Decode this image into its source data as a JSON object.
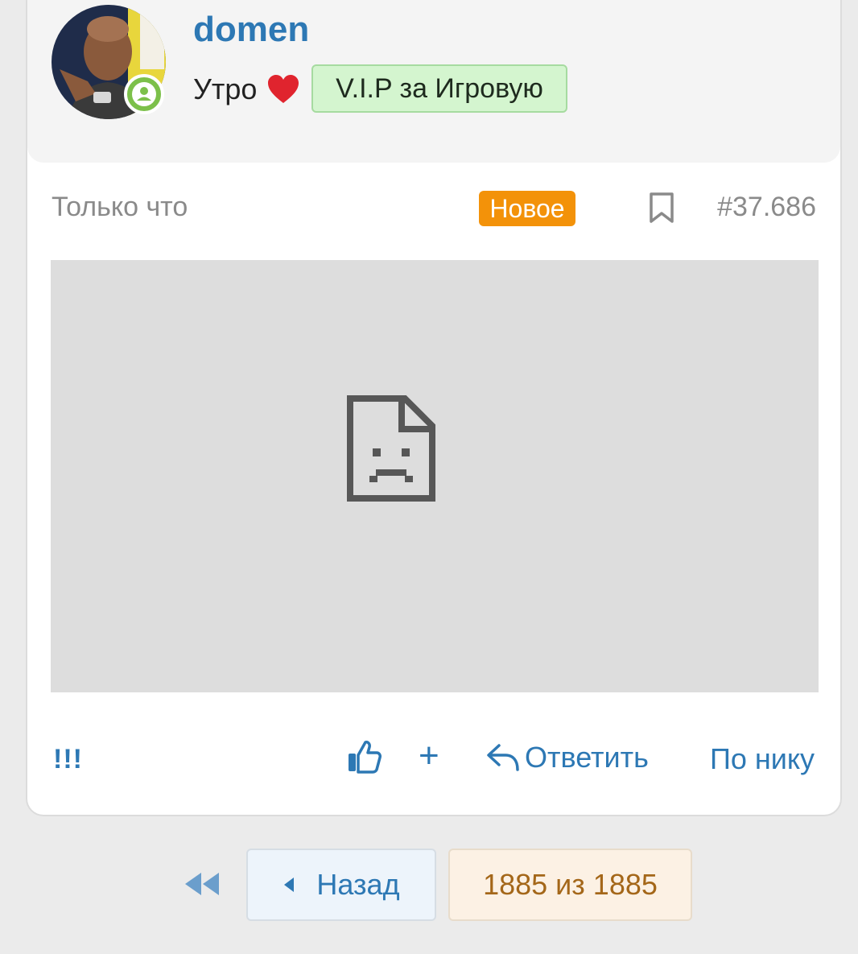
{
  "post": {
    "author": {
      "username": "domen",
      "title": "Утро",
      "badge": "V.I.P за Игровую",
      "online": true
    },
    "time": "Только что",
    "new_label": "Новое",
    "number": "#37.686",
    "image_state": "broken-image",
    "actions": {
      "exclamation": "!!!",
      "plus": "+",
      "reply": "Ответить",
      "by_nick": "По нику"
    }
  },
  "pagination": {
    "back_label": "Назад",
    "page_indicator": "1885 из 1885"
  },
  "colors": {
    "accent": "#2d78b4",
    "new_badge": "#f39209",
    "vip_badge_bg": "#d4f5cf",
    "online": "#7cc04a",
    "page_indicator_text": "#a46719"
  },
  "icons": {
    "online_badge": "user-icon",
    "heart": "heart-icon",
    "bookmark": "bookmark-icon",
    "broken_image": "broken-image-icon",
    "like": "thumbs-up-icon",
    "reply": "reply-icon",
    "first_page": "double-chevron-left-icon",
    "prev": "caret-left-icon"
  }
}
